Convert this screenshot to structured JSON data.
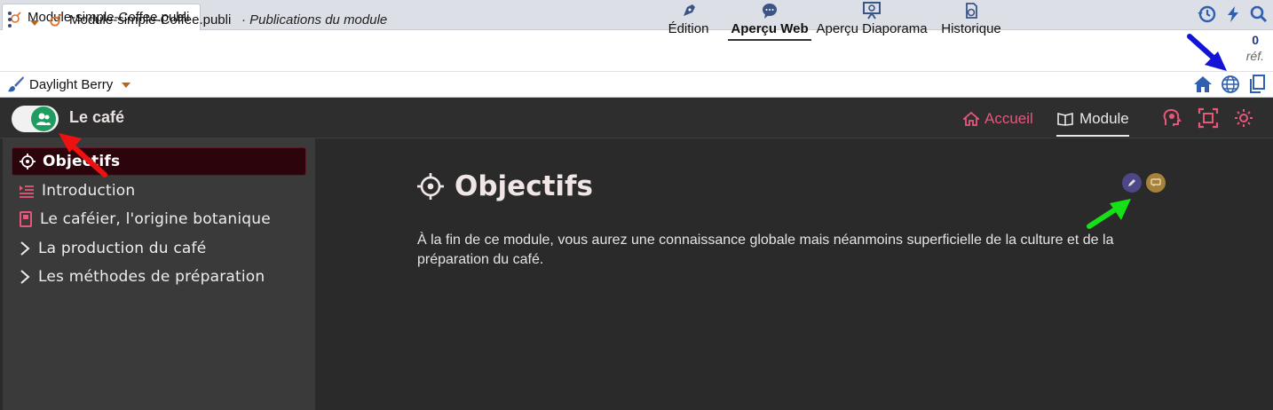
{
  "tab": {
    "label": "Module-simple-Coffee.publi"
  },
  "toolbar": {
    "pub_title": "Module-simple-Coffee.publi",
    "pub_subtitle": "· Publications du module",
    "tools": [
      {
        "label": "Édition"
      },
      {
        "label": "Aperçu Web"
      },
      {
        "label": "Aperçu Diaporama"
      },
      {
        "label": "Historique"
      }
    ],
    "ref_count": "0",
    "ref_label": "réf."
  },
  "skin": {
    "label": "Daylight Berry"
  },
  "preview": {
    "site_title": "Le café",
    "nav": {
      "home": "Accueil",
      "module": "Module"
    },
    "sidebar": [
      {
        "label": "Objectifs",
        "icon": "target-icon"
      },
      {
        "label": "Introduction",
        "icon": "list-indent-icon"
      },
      {
        "label": "Le caféier, l'origine botanique",
        "icon": "book-icon"
      },
      {
        "label": "La production du café",
        "icon": "chevron-right-icon"
      },
      {
        "label": "Les méthodes de préparation",
        "icon": "chevron-right-icon"
      }
    ],
    "content": {
      "title": "Objectifs",
      "text": "À la fin de ce module, vous aurez une connaissance globale mais néanmoins superficielle de la culture et de la préparation du café."
    }
  },
  "colors": {
    "accent_pink": "#e7577a",
    "toggle_green": "#1f9d60",
    "active_item_bg": "#2c040c",
    "toolbar_blue": "#2f5fb0"
  }
}
